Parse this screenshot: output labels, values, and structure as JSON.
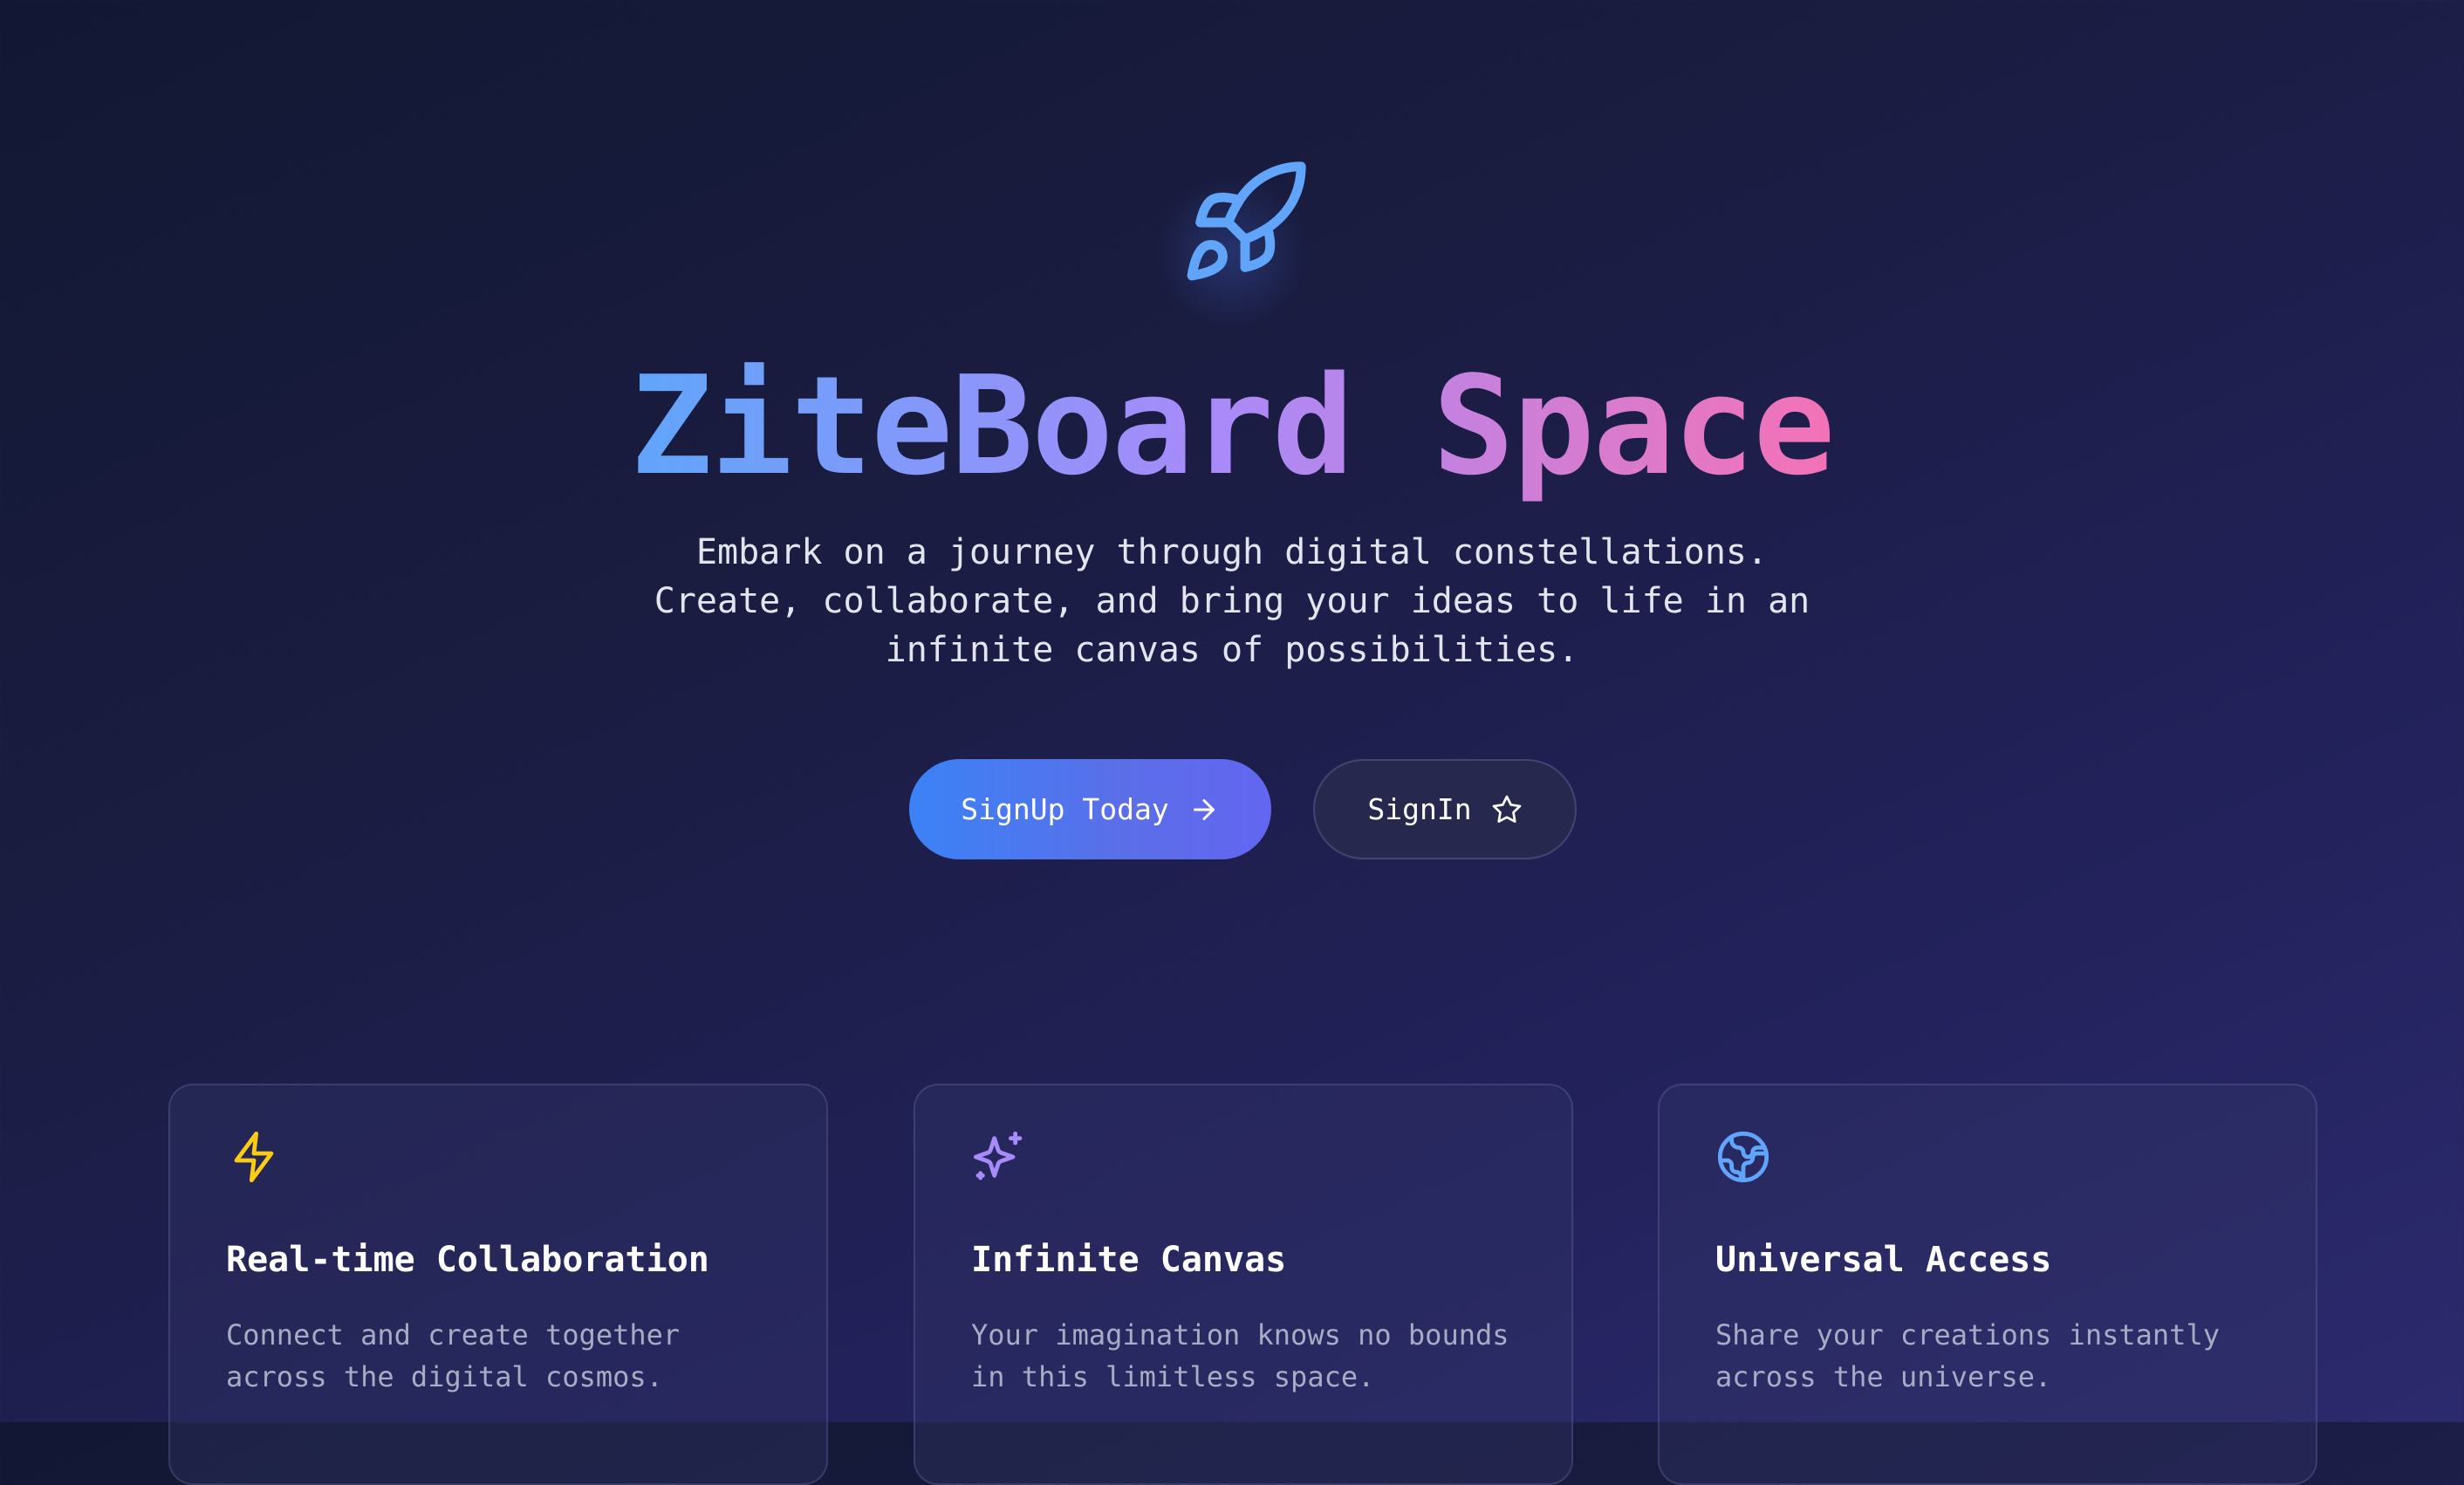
{
  "hero": {
    "icon": "rocket-icon",
    "title": "ZiteBoard Space",
    "subtitle": "Embark on a journey through digital constellations.\nCreate, collaborate, and bring your ideas to life in an\ninfinite canvas of possibilities."
  },
  "actions": {
    "signup_label": "SignUp Today",
    "signup_icon": "arrow-right-icon",
    "signin_label": "SignIn",
    "signin_icon": "star-icon"
  },
  "features": [
    {
      "icon": "lightning-icon",
      "icon_color": "#facc15",
      "title": "Real-time Collaboration",
      "description": "Connect and create together\nacross the digital cosmos."
    },
    {
      "icon": "sparkles-icon",
      "icon_color": "#a78bfa",
      "title": "Infinite Canvas",
      "description": "Your imagination knows no bounds\nin this limitless space."
    },
    {
      "icon": "globe-icon",
      "icon_color": "#60a5fa",
      "title": "Universal Access",
      "description": "Share your creations instantly\nacross the universe."
    }
  ],
  "colors": {
    "accent_blue": "#60a5fa",
    "accent_purple": "#a78bfa",
    "accent_pink": "#f472b6",
    "primary_button": "#3b82f6",
    "background": "#1a1c40"
  }
}
